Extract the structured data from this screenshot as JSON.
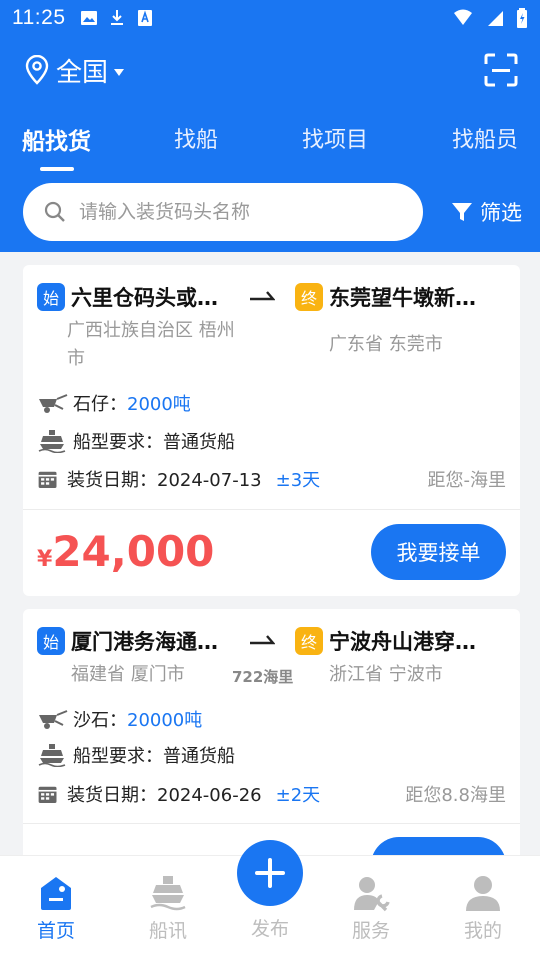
{
  "status_bar": {
    "time": "11:25"
  },
  "location": {
    "label": "全国"
  },
  "tabs": [
    {
      "label": "船找货",
      "active": true
    },
    {
      "label": "找船",
      "active": false
    },
    {
      "label": "找项目",
      "active": false
    },
    {
      "label": "找船员",
      "active": false
    }
  ],
  "search": {
    "placeholder": "请输入装货码头名称",
    "value": ""
  },
  "filter": {
    "label": "筛选"
  },
  "cards": [
    {
      "start_badge": "始",
      "end_badge": "终",
      "origin": "六里仓码头或…",
      "origin_region": "广西壮族自治区 梧州市",
      "destination": "东莞望牛墩新…",
      "destination_region": "广东省 东莞市",
      "distance": "",
      "cargo_label": "石仔：",
      "cargo_qty": "2000吨",
      "ship_req": "船型要求：普通货船",
      "load_date": "装货日期：2024-07-13",
      "load_flex": "±3天",
      "distance_to_you": "距您-海里",
      "price_symbol": "¥",
      "price": "24,000",
      "action_label": "我要接单"
    },
    {
      "start_badge": "始",
      "end_badge": "终",
      "origin": "厦门港务海通…",
      "origin_region": "福建省 厦门市",
      "destination": "宁波舟山港穿…",
      "destination_region": "浙江省 宁波市",
      "distance": "722海里",
      "cargo_label": "沙石：",
      "cargo_qty": "20000吨",
      "ship_req": "船型要求：普通货船",
      "load_date": "装货日期：2024-06-26",
      "load_flex": "±2天",
      "distance_to_you": "距您8.8海里"
    }
  ],
  "bottom_nav": [
    {
      "label": "首页",
      "icon": "home-icon",
      "active": true
    },
    {
      "label": "船讯",
      "icon": "ship-icon",
      "active": false
    },
    {
      "label": "发布",
      "icon": "plus-icon",
      "active": false
    },
    {
      "label": "服务",
      "icon": "service-icon",
      "active": false
    },
    {
      "label": "我的",
      "icon": "user-icon",
      "active": false
    }
  ],
  "colors": {
    "primary": "#1a76f2",
    "price": "#f55353",
    "end_badge": "#f9b312"
  }
}
